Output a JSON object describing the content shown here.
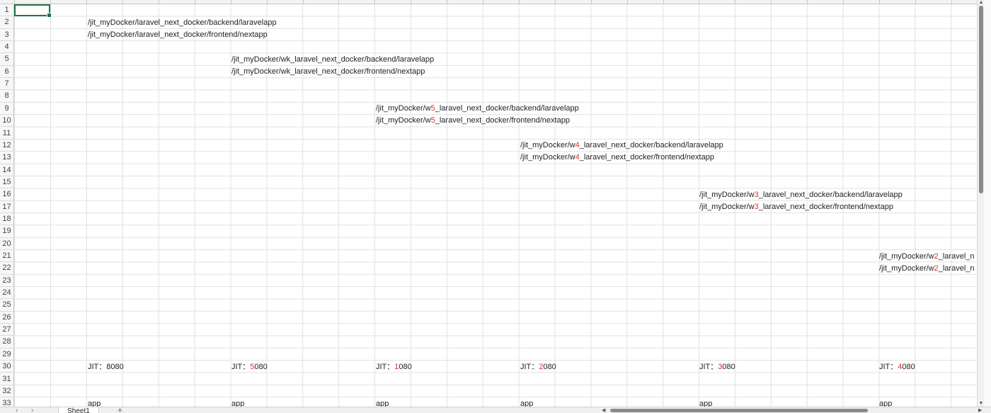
{
  "sheet": {
    "tab_name": "Sheet1",
    "add_sheet_label": "+",
    "row_numbers": [
      "1",
      "2",
      "3",
      "4",
      "5",
      "6",
      "7",
      "8",
      "9",
      "10",
      "11",
      "12",
      "13",
      "14",
      "15",
      "16",
      "17",
      "18",
      "19",
      "20",
      "21",
      "22",
      "23",
      "24",
      "25",
      "26",
      "27",
      "28",
      "29",
      "30",
      "31",
      "32",
      "33"
    ]
  },
  "cells": {
    "r2": "/jit_myDocker/laravel_next_docker/backend/laravelapp",
    "r3": "/jit_myDocker/laravel_next_docker/frontend/nextapp",
    "r5": "/jit_myDocker/wk_laravel_next_docker/backend/laravelapp",
    "r6": "/jit_myDocker/wk_laravel_next_docker/frontend/nextapp",
    "r9": {
      "pre": "/jit_myDocker/w",
      "hl": "5",
      "post": "_laravel_next_docker/backend/laravelapp"
    },
    "r10": {
      "pre": "/jit_myDocker/w",
      "hl": "5",
      "post": "_laravel_next_docker/frontend/nextapp"
    },
    "r12": {
      "pre": "/jit_myDocker/w",
      "hl": "4",
      "post": "_laravel_next_docker/backend/laravelapp"
    },
    "r13": {
      "pre": "/jit_myDocker/w",
      "hl": "4",
      "post": "_laravel_next_docker/frontend/nextapp"
    },
    "r16": {
      "pre": "/jit_myDocker/w",
      "hl": "3",
      "post": "_laravel_next_docker/backend/laravelapp"
    },
    "r17": {
      "pre": "/jit_myDocker/w",
      "hl": "3",
      "post": "_laravel_next_docker/frontend/nextapp"
    },
    "r21": {
      "pre": "/jit_myDocker/w",
      "hl": "2",
      "post": "_laravel_n"
    },
    "r22": {
      "pre": "/jit_myDocker/w",
      "hl": "2",
      "post": "_laravel_n"
    },
    "ports": [
      {
        "pre": "JIT：",
        "hl": "",
        "post": "8080"
      },
      {
        "pre": "JIT：",
        "hl": "5",
        "post": "080"
      },
      {
        "pre": "JIT：",
        "hl": "1",
        "post": "080"
      },
      {
        "pre": "JIT：",
        "hl": "2",
        "post": "080"
      },
      {
        "pre": "JIT：",
        "hl": "3",
        "post": "080"
      },
      {
        "pre": "JIT：",
        "hl": "4",
        "post": "080"
      }
    ],
    "app_label": "app"
  },
  "colors": {
    "selection": "#217346",
    "highlight": "#e0322e",
    "grid": "#e1e1e1"
  },
  "icons": {
    "scroll_up": "▲",
    "scroll_down": "▼",
    "scroll_left": "◀",
    "scroll_right": "▶",
    "nav_prev": "‹",
    "nav_next": "›"
  }
}
